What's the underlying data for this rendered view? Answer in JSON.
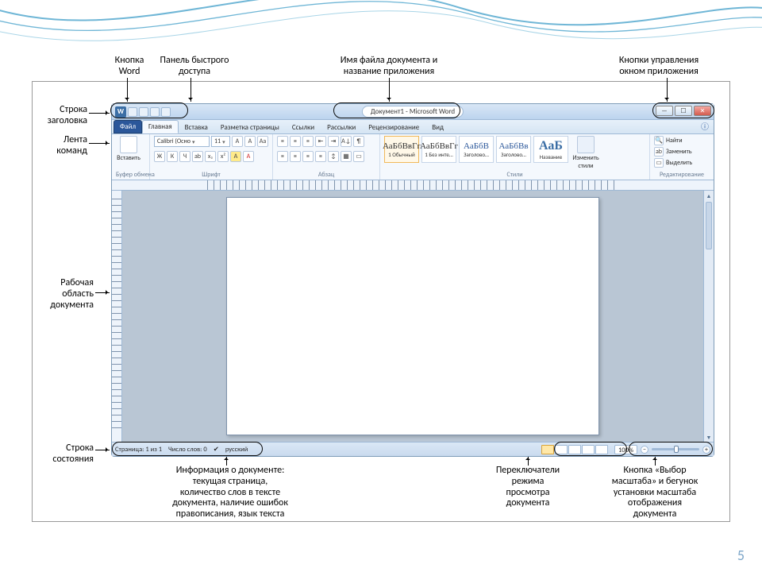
{
  "slide_number": "5",
  "callouts": {
    "title_row": "Строка\nзаголовка",
    "word_button": "Кнопка\nWord",
    "quick_access": "Панель быстрого\nдоступа",
    "file_title": "Имя файла документа и\nназвание приложения",
    "window_controls": "Кнопки управления\nокном приложения",
    "ribbon": "Лента\nкоманд",
    "workspace": "Рабочая\nобласть\nдокумента",
    "statusbar": "Строка\nсостояния",
    "doc_info": "Информация о документе:\nтекущая страница,\nколичество слов в тексте\nдокумента, наличие ошибок\nправописания, язык текста",
    "view_switch": "Переключатели\nрежима\nпросмотра\nдокумента",
    "zoom": "Кнопка «Выбор\nмасштаба» и бегунок\nустановки масштаба\nотображения\nдокумента"
  },
  "word": {
    "title": "Документ1 - Microsoft Word",
    "tabs": {
      "file": "Файл",
      "home": "Главная",
      "insert": "Вставка",
      "layout": "Разметка страницы",
      "refs": "Ссылки",
      "mail": "Рассылки",
      "review": "Рецензирование",
      "view": "Вид"
    },
    "ribbon": {
      "clipboard": {
        "label": "Буфер обмена",
        "paste": "Вставить"
      },
      "font": {
        "label": "Шрифт",
        "name": "Calibri (Осно",
        "size": "11",
        "buttons": [
          "Ж",
          "К",
          "Ч"
        ]
      },
      "paragraph": {
        "label": "Абзац"
      },
      "styles": {
        "label": "Стили",
        "items": [
          {
            "sample": "АаБбВвГг",
            "name": "1 Обычный"
          },
          {
            "sample": "АаБбВвГг",
            "name": "1 Без инте…"
          },
          {
            "sample": "АаБбВ",
            "name": "Заголово…"
          },
          {
            "sample": "АаБбВв",
            "name": "Заголово…"
          },
          {
            "sample": "АаБ",
            "name": "Название"
          }
        ],
        "change": "Изменить\nстили"
      },
      "editing": {
        "label": "Редактирование",
        "find": "Найти",
        "replace": "Заменить",
        "select": "Выделить"
      }
    },
    "status": {
      "page": "Страница: 1 из 1",
      "words": "Число слов: 0",
      "lang": "русский",
      "zoom": "100%"
    }
  }
}
